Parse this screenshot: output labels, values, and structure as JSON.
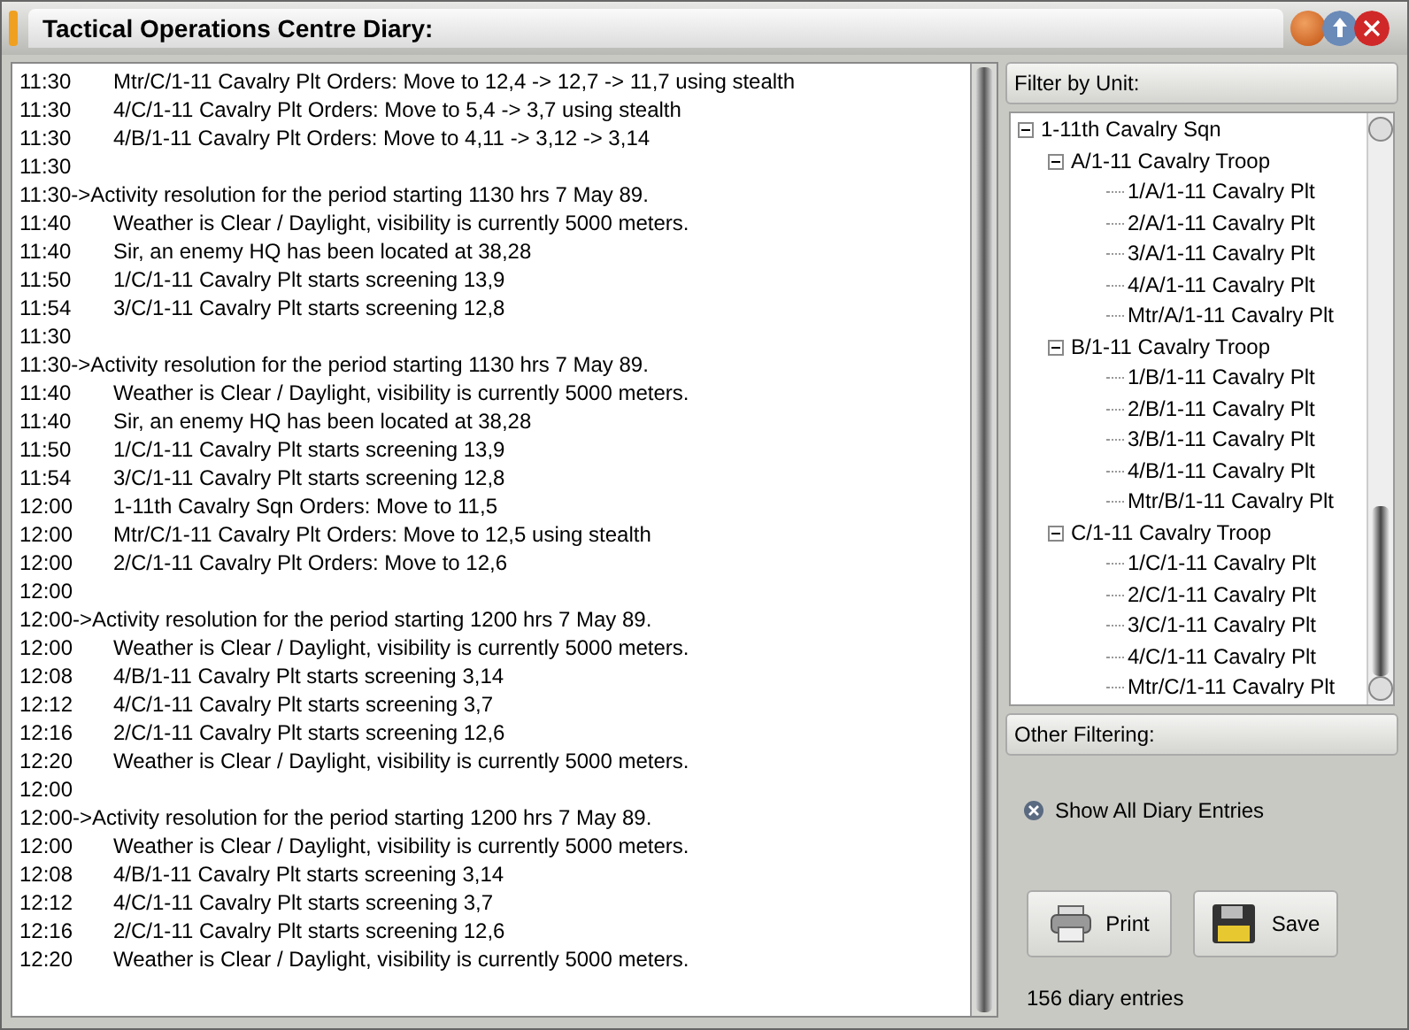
{
  "window": {
    "title": "Tactical Operations Centre Diary:"
  },
  "diary": [
    {
      "kind": "entry",
      "time": "11:30",
      "text": "Mtr/C/1-11 Cavalry Plt Orders: Move to 12,4 -> 12,7 -> 11,7 using stealth"
    },
    {
      "kind": "entry",
      "time": "11:30",
      "text": "4/C/1-11 Cavalry Plt Orders: Move to 5,4 -> 3,7 using stealth"
    },
    {
      "kind": "entry",
      "time": "11:30",
      "text": "4/B/1-11 Cavalry Plt Orders: Move to 4,11 -> 3,12 -> 3,14"
    },
    {
      "kind": "entry",
      "time": "11:30"
    },
    {
      "kind": "header",
      "text": "11:30->Activity resolution for the period starting 1130 hrs 7 May 89."
    },
    {
      "kind": "entry",
      "time": "11:40",
      "text": "Weather is Clear / Daylight, visibility is currently 5000 meters."
    },
    {
      "kind": "entry",
      "time": "11:40",
      "text": "Sir, an enemy HQ has been located at 38,28"
    },
    {
      "kind": "entry",
      "time": "11:50",
      "text": "1/C/1-11 Cavalry Plt starts screening 13,9"
    },
    {
      "kind": "entry",
      "time": "11:54",
      "text": "3/C/1-11 Cavalry Plt starts screening 12,8"
    },
    {
      "kind": "entry",
      "time": "11:30"
    },
    {
      "kind": "header",
      "text": "11:30->Activity resolution for the period starting 1130 hrs 7 May 89."
    },
    {
      "kind": "entry",
      "time": "11:40",
      "text": "Weather is Clear / Daylight, visibility is currently 5000 meters."
    },
    {
      "kind": "entry",
      "time": "11:40",
      "text": "Sir, an enemy HQ has been located at 38,28"
    },
    {
      "kind": "entry",
      "time": "11:50",
      "text": "1/C/1-11 Cavalry Plt starts screening 13,9"
    },
    {
      "kind": "entry",
      "time": "11:54",
      "text": "3/C/1-11 Cavalry Plt starts screening 12,8"
    },
    {
      "kind": "entry",
      "time": "12:00",
      "text": "1-11th Cavalry Sqn Orders: Move to 11,5"
    },
    {
      "kind": "entry",
      "time": "12:00",
      "text": "Mtr/C/1-11 Cavalry Plt Orders: Move to 12,5 using stealth"
    },
    {
      "kind": "entry",
      "time": "12:00",
      "text": "2/C/1-11 Cavalry Plt Orders: Move to 12,6"
    },
    {
      "kind": "entry",
      "time": "12:00"
    },
    {
      "kind": "header",
      "text": "12:00->Activity resolution for the period starting 1200 hrs 7 May 89."
    },
    {
      "kind": "entry",
      "time": "12:00",
      "text": "Weather is Clear / Daylight, visibility is currently 5000 meters."
    },
    {
      "kind": "entry",
      "time": "12:08",
      "text": "4/B/1-11 Cavalry Plt starts screening 3,14"
    },
    {
      "kind": "entry",
      "time": "12:12",
      "text": "4/C/1-11 Cavalry Plt starts screening 3,7"
    },
    {
      "kind": "entry",
      "time": "12:16",
      "text": "2/C/1-11 Cavalry Plt starts screening 12,6"
    },
    {
      "kind": "entry",
      "time": "12:20",
      "text": "Weather is Clear / Daylight, visibility is currently 5000 meters."
    },
    {
      "kind": "entry",
      "time": "12:00"
    },
    {
      "kind": "header",
      "text": "12:00->Activity resolution for the period starting 1200 hrs 7 May 89."
    },
    {
      "kind": "entry",
      "time": "12:00",
      "text": "Weather is Clear / Daylight, visibility is currently 5000 meters."
    },
    {
      "kind": "entry",
      "time": "12:08",
      "text": "4/B/1-11 Cavalry Plt starts screening 3,14"
    },
    {
      "kind": "entry",
      "time": "12:12",
      "text": "4/C/1-11 Cavalry Plt starts screening 3,7"
    },
    {
      "kind": "entry",
      "time": "12:16",
      "text": "2/C/1-11 Cavalry Plt starts screening 12,6"
    },
    {
      "kind": "entry",
      "time": "12:20",
      "text": "Weather is Clear / Daylight, visibility is currently 5000 meters."
    }
  ],
  "filter_by_unit": {
    "title": "Filter by Unit:",
    "tree": [
      {
        "label": "1-11th Cavalry Sqn",
        "expanded": true,
        "children": [
          {
            "label": "A/1-11 Cavalry Troop",
            "expanded": true,
            "children": [
              {
                "label": "1/A/1-11 Cavalry Plt"
              },
              {
                "label": "2/A/1-11 Cavalry Plt"
              },
              {
                "label": "3/A/1-11 Cavalry Plt"
              },
              {
                "label": "4/A/1-11 Cavalry Plt"
              },
              {
                "label": "Mtr/A/1-11 Cavalry Plt"
              }
            ]
          },
          {
            "label": "B/1-11 Cavalry Troop",
            "expanded": true,
            "children": [
              {
                "label": "1/B/1-11 Cavalry Plt"
              },
              {
                "label": "2/B/1-11 Cavalry Plt"
              },
              {
                "label": "3/B/1-11 Cavalry Plt"
              },
              {
                "label": "4/B/1-11 Cavalry Plt"
              },
              {
                "label": "Mtr/B/1-11 Cavalry Plt"
              }
            ]
          },
          {
            "label": "C/1-11 Cavalry Troop",
            "expanded": true,
            "children": [
              {
                "label": "1/C/1-11 Cavalry Plt"
              },
              {
                "label": "2/C/1-11 Cavalry Plt"
              },
              {
                "label": "3/C/1-11 Cavalry Plt"
              },
              {
                "label": "4/C/1-11 Cavalry Plt"
              },
              {
                "label": "Mtr/C/1-11 Cavalry Plt"
              }
            ]
          }
        ]
      }
    ]
  },
  "other_filtering": {
    "title": "Other Filtering:",
    "options": [
      {
        "label": "Show All Diary Entries",
        "checked": true
      }
    ]
  },
  "buttons": [
    {
      "kind": "print",
      "label": "Print"
    },
    {
      "kind": "save",
      "label": "Save"
    }
  ],
  "status": "156 diary entries"
}
